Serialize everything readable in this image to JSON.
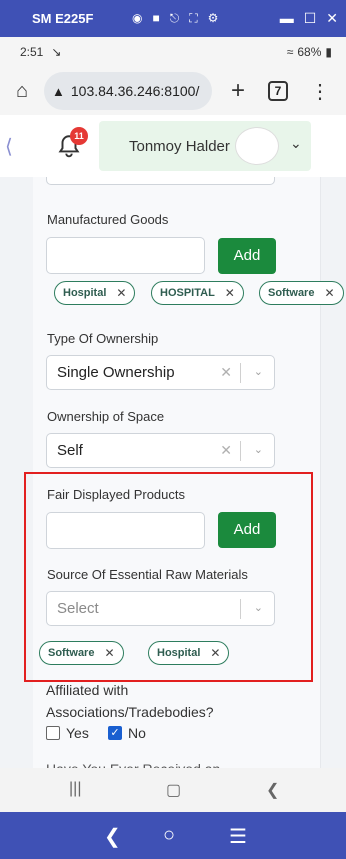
{
  "titlebar": {
    "device_name": "SM E225F",
    "icons": [
      "camera-icon",
      "video-icon",
      "headphones-icon",
      "expand-icon",
      "gear-icon"
    ],
    "window_controls": [
      "minimize-icon",
      "maximize-icon",
      "close-icon"
    ]
  },
  "status": {
    "time": "2:51",
    "battery": "68%"
  },
  "browser": {
    "url": "103.84.36.246:8100/",
    "tab_count": "7"
  },
  "header": {
    "notification_count": "11",
    "user_name": "Tonmoy Halder"
  },
  "form": {
    "manufactured_goods_label": "Manufactured Goods",
    "add_label": "Add",
    "manufactured_goods_chips": [
      "Hospital",
      "HOSPITAL",
      "Software"
    ],
    "type_of_ownership_label": "Type Of Ownership",
    "type_of_ownership_value": "Single Ownership",
    "ownership_space_label": "Ownership of Space",
    "ownership_space_value": "Self",
    "fair_products_label": "Fair Displayed Products",
    "raw_materials_label": "Source Of Essential Raw Materials",
    "raw_materials_placeholder": "Select",
    "raw_materials_chips": [
      "Software",
      "Hospital"
    ],
    "affiliated_label_line1": "Affiliated with",
    "affiliated_label_line2": "Associations/Tradebodies?",
    "yes_label": "Yes",
    "no_label": "No",
    "yes_checked": false,
    "no_checked": true,
    "next_question_partial": "Have You Ever Received an"
  },
  "colors": {
    "accent": "#3f51b5",
    "add_button": "#1b8a3d",
    "chip_border": "#2e7d5e",
    "highlight": "#e21f1f"
  }
}
